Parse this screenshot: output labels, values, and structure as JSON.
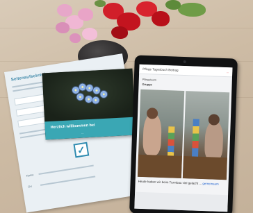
{
  "flyer": {
    "heading": "Seitenaufschrieb",
    "check_mark": "✓",
    "field_labels": [
      "Name",
      "Ort"
    ]
  },
  "postcard": {
    "title": "Herzlich willkommen bei",
    "subtitle": "..."
  },
  "tablet": {
    "app_title": "Pflege Tagesbuch Beitrag",
    "app_action": "...",
    "post_meta": "Pflegeteam",
    "post_author": "Gruppe",
    "caption_text": "Heute haben wir beim Turmbau viel gelacht ... ",
    "caption_link": "gemeinsam"
  },
  "colors": {
    "teal_banner": "#3aa7b4",
    "flyer_blue": "#3a86a8",
    "accent_red": "#e23c3c",
    "link_blue": "#2b6ad1"
  }
}
